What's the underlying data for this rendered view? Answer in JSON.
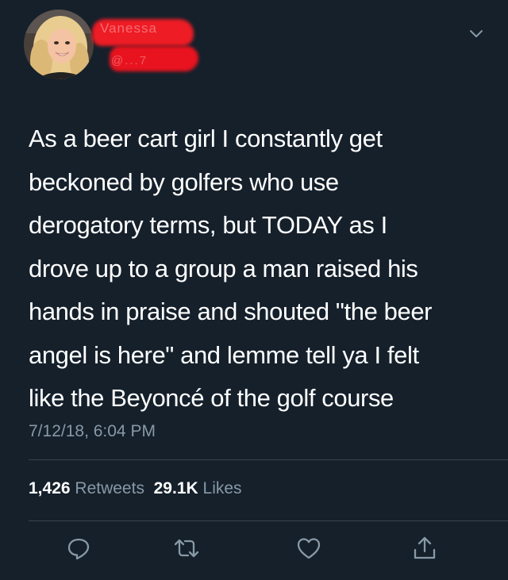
{
  "author": {
    "display_name_redacted": "Vanessa",
    "handle_redacted": "@...7"
  },
  "tweet": {
    "text": "As a beer cart girl I constantly get\nbeckoned by golfers who use\nderogatory terms, but TODAY as I\ndrove up to a group a man raised his\nhands in praise and shouted \"the beer\nangel is here\" and lemme tell ya I felt\nlike the Beyoncé of the golf course",
    "timestamp": "7/12/18, 6:04 PM"
  },
  "stats": {
    "retweets_count": "1,426",
    "retweets_label": "Retweets",
    "likes_count": "29.1K",
    "likes_label": "Likes"
  },
  "icons": {
    "more": "chevron-down-icon",
    "reply": "reply-icon",
    "retweet": "retweet-icon",
    "like": "heart-icon",
    "share": "share-icon"
  },
  "colors": {
    "background": "#15202b",
    "text": "#ffffff",
    "secondary": "#8899a6",
    "divider": "#38444d",
    "redaction": "#ee1c25"
  }
}
